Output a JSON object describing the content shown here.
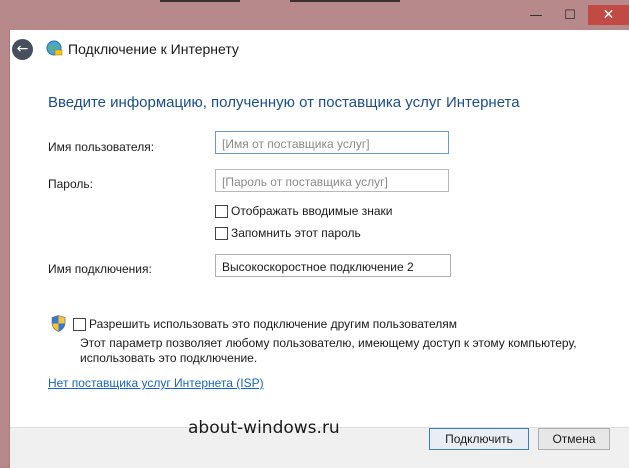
{
  "window": {
    "title": "Подключение к Интернету",
    "controls": {
      "minimize": "—",
      "maximize": "☐",
      "close": "✕"
    }
  },
  "heading": "Введите информацию, полученную от поставщика услуг Интернета",
  "form": {
    "username_label": "Имя пользователя:",
    "username_placeholder": "[Имя от поставщика услуг]",
    "password_label": "Пароль:",
    "password_placeholder": "[Пароль от поставщика услуг]",
    "show_chars_label": "Отображать вводимые знаки",
    "remember_label": "Запомнить этот пароль",
    "connection_name_label": "Имя подключения:",
    "connection_name_value": "Высокоскоростное подключение 2"
  },
  "share": {
    "label": "Разрешить использовать это подключение другим пользователям",
    "description": "Этот параметр позволяет любому пользователю, имеющему доступ к этому компьютеру, использовать это подключение."
  },
  "no_isp_link": "Нет поставщика услуг Интернета (ISP)",
  "watermark": "about-windows.ru",
  "buttons": {
    "connect": "Подключить",
    "cancel": "Отмена"
  }
}
